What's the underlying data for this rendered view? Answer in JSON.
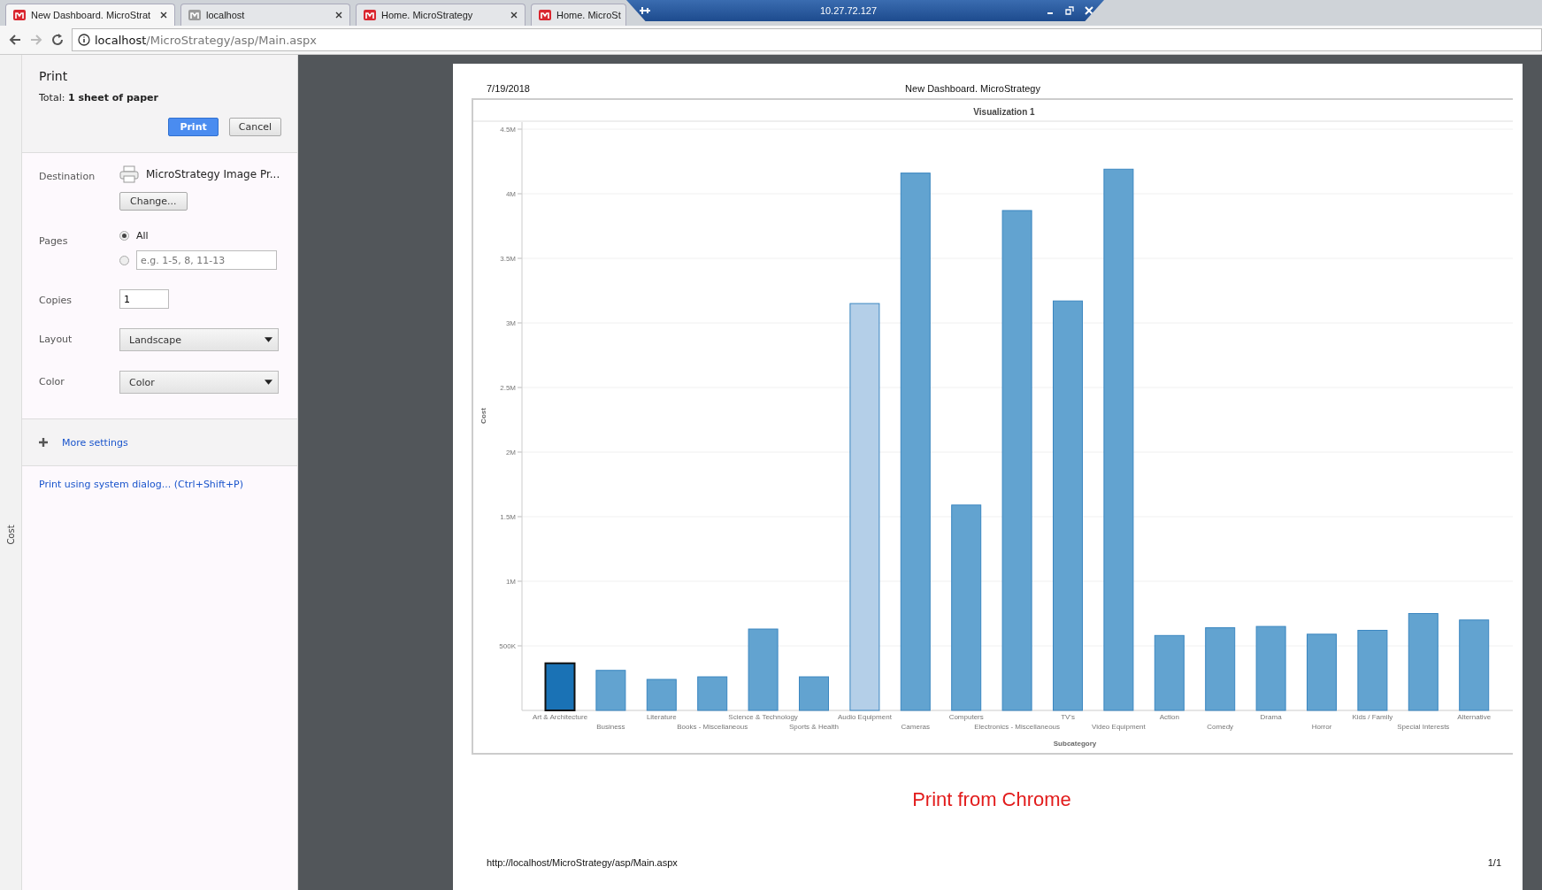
{
  "browser": {
    "tabs": [
      {
        "title": "New Dashboard. MicroStrat",
        "selected": true,
        "kind": "brand"
      },
      {
        "title": "localhost",
        "selected": false,
        "kind": "plain"
      },
      {
        "title": "Home. MicroStrategy",
        "selected": false,
        "kind": "brand"
      },
      {
        "title": "Home. MicroSt",
        "selected": false,
        "kind": "brand"
      }
    ],
    "remote_bar": {
      "title": "10.27.72.127"
    },
    "address": {
      "host": "localhost",
      "path": "/MicroStrategy/asp/Main.aspx"
    }
  },
  "side_strip": {
    "label": "Cost"
  },
  "print_panel": {
    "title": "Print",
    "total": "Total: **1 sheet of paper**",
    "buttons": [
      {
        "label": "Print",
        "kind": "primary"
      },
      {
        "label": "Cancel",
        "kind": "secondary"
      }
    ],
    "destination": {
      "label": "Destination",
      "name": "MicroStrategy Image Pr...",
      "button": "Change..."
    },
    "pages": {
      "label": "Pages",
      "options": [
        {
          "label": "All",
          "selected": true
        },
        {
          "placeholder": "e.g. 1-5, 8, 11-13",
          "selected": false
        }
      ]
    },
    "copies": {
      "label": "Copies",
      "value": "1"
    },
    "layout": {
      "label": "Layout",
      "value": "Landscape"
    },
    "color": {
      "label": "Color",
      "value": "Color"
    },
    "more_settings": "More settings",
    "system_dialog": "Print using system dialog... (Ctrl+Shift+P)"
  },
  "preview": {
    "date": "7/19/2018",
    "header": "New Dashboard. MicroStrategy",
    "note": "Print from Chrome",
    "footer_url": "http://localhost/MicroStrategy/asp/Main.aspx",
    "page_number": "1/1",
    "visualization": {
      "chart_data": {
        "type": "bar",
        "title": "Visualization 1",
        "xlabel": "Subcategory",
        "ylabel": "Cost",
        "stacked": true,
        "categories": [
          "Art & Architecture",
          "Business",
          "Literature",
          "Books - Miscellaneous",
          "Science & Technology",
          "Sports & Health",
          "Audio Equipment",
          "Cameras",
          "Computers",
          "Electronics - Miscellaneous",
          "TV's",
          "Video Equipment",
          "Action",
          "Comedy",
          "Drama",
          "Horror",
          "Kids / Family",
          "Special Interests",
          "Alternative"
        ],
        "grid": true,
        "series": [
          {
            "color": "#62a3d0",
            "values": [
              null,
              310000,
              240000,
              260000,
              630000,
              260000,
              null,
              4160000,
              1590000,
              3870000,
              3170000,
              4190000,
              580000,
              640000,
              650000,
              590000,
              620000,
              750000,
              700000
            ]
          },
          {
            "color": "#1a72b5",
            "values": [
              365000,
              null,
              null,
              null,
              null,
              null,
              null,
              null,
              null,
              null,
              null,
              null,
              null,
              null,
              null,
              null,
              null,
              null,
              null
            ]
          },
          {
            "color": "#b4cfe8",
            "values": [
              null,
              null,
              null,
              null,
              null,
              null,
              3150000,
              null,
              null,
              null,
              null,
              null,
              null,
              null,
              null,
              null,
              null,
              null,
              null
            ]
          }
        ],
        "ylim": [
          0,
          4500000
        ],
        "yticks": [
          {
            "value": 500000,
            "label": "500K"
          },
          {
            "value": 1000000,
            "label": "1M"
          },
          {
            "value": 1500000,
            "label": "1.5M"
          },
          {
            "value": 2000000,
            "label": "2M"
          },
          {
            "value": 2500000,
            "label": "2.5M"
          },
          {
            "value": 3000000,
            "label": "3M"
          },
          {
            "value": 3500000,
            "label": "3.5M"
          },
          {
            "value": 4000000,
            "label": "4M"
          },
          {
            "value": 4500000,
            "label": "4.5M"
          }
        ]
      }
    }
  }
}
